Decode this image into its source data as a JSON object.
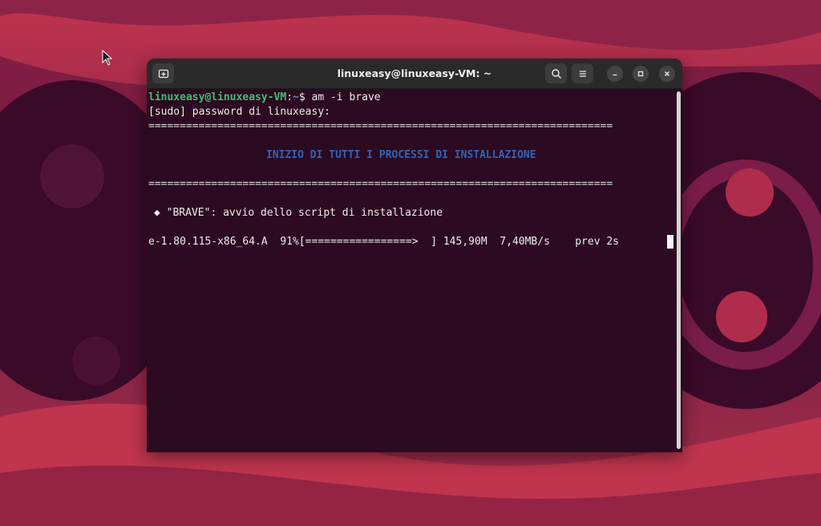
{
  "window": {
    "title": "linuxeasy@linuxeasy-VM: ~"
  },
  "icons": {
    "new_tab": "new-tab-icon",
    "search": "search-icon",
    "menu": "hamburger-menu-icon",
    "minimize": "minimize-icon",
    "maximize": "maximize-icon",
    "close": "close-icon",
    "pointer": "mouse-pointer-icon"
  },
  "terminal": {
    "prompt_user": "linuxeasy@linuxeasy-VM",
    "prompt_colon": ":",
    "prompt_dir": "~",
    "prompt_symbol": "$ ",
    "command": "am -i brave",
    "sudo_prompt": "[sudo] password di linuxeasy:",
    "separator": "==========================================================================",
    "heading": "INIZIO DI TUTTI I PROCESSI DI INSTALLAZIONE",
    "bullet": "◆",
    "status_line": "\"BRAVE\": avvio dello script di installazione",
    "progress_line": "e-1.80.115-x86_64.A  91%[=================>  ] 145,90M  7,40MB/s    prev 2s"
  },
  "colors": {
    "terminal_bg": "#2c0a21",
    "prompt_green": "#3fbf6f",
    "heading_blue": "#2f64b8",
    "titlebar_bg": "#2a2a2a"
  }
}
